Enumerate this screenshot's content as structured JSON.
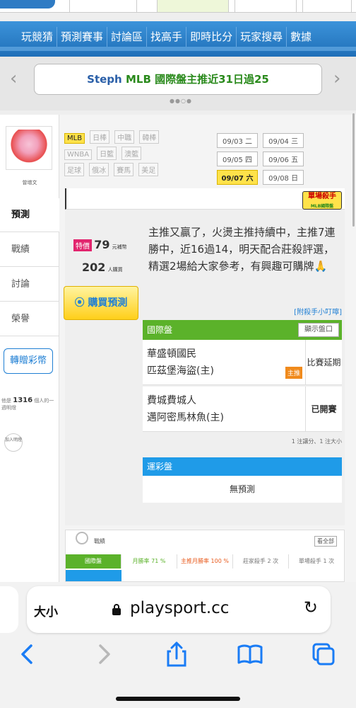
{
  "top_tabs": [
    "",
    "",
    "",
    ""
  ],
  "nav": {
    "items": [
      "玩競猜",
      "預測賽事",
      "討論區",
      "找高手",
      "即時比分",
      "玩家搜尋",
      "數據"
    ]
  },
  "banner": {
    "prefix": "Steph",
    "text": "MLB 國際盤主推近31日過25",
    "left_arrow": "‹",
    "right_arrow": "›"
  },
  "profile": {
    "owner_name": "曾增文",
    "tabs": [
      "預測",
      "戰績",
      "討論",
      "榮譽"
    ],
    "gift_label": "轉贈彩幣",
    "fans_prefix": "他是",
    "fans_count": "1316",
    "fans_suffix": "個人的一週明燈",
    "join_label": "加入明燈"
  },
  "filters": {
    "leagues": [
      "MLB",
      "日棒",
      "中職",
      "韓棒",
      "WNBA",
      "日籃",
      "澳籃",
      "足球",
      "俄冰",
      "賽馬",
      "美足"
    ],
    "active_league": "MLB",
    "dates": [
      "09/03 二",
      "09/04 三",
      "09/05 四",
      "09/06 五",
      "09/07 六",
      "09/08 日"
    ],
    "active_date": "09/07 六"
  },
  "badge": {
    "title": "單場殺手",
    "subtitle": "MLB國際盤"
  },
  "prediction": {
    "special_tag": "特價",
    "price": "79",
    "price_unit": "元補幣",
    "buyers": "202",
    "buyers_unit": "人購買",
    "buy_label": "購買預測",
    "description": "主推又贏了，火燙主推持續中，主推7連勝中，近16過14，明天配合莊殺評選，精選2場給大家參考，有興趣可購牌🙏",
    "help_link": "[附殺手小叮嚀]",
    "intl_title": "國際盤",
    "show_line": "顯示盤口",
    "games": [
      {
        "away": "華盛頓國民",
        "home": "匹茲堡海盜(主)",
        "status": "比賽延期",
        "main_tag": "主推"
      },
      {
        "away": "費城費城人",
        "home": "邁阿密馬林魚(主)",
        "status": "已開賽",
        "main_tag": ""
      }
    ],
    "note": "1 注讓分、1 注大小",
    "lottery_title": "運彩盤",
    "no_prediction": "無預測"
  },
  "record": {
    "title": "戰績",
    "see_all": "看全部",
    "row": {
      "label": "國際盤",
      "month_rate": "月勝率 71 %",
      "main_month_rate": "主推月勝率 100 %",
      "banker_kill": "莊家殺手 2 次",
      "single_kill": "單場殺手 1 次"
    }
  },
  "browser": {
    "text_size": "大小",
    "url": "playsport.cc",
    "reload": "↻"
  }
}
